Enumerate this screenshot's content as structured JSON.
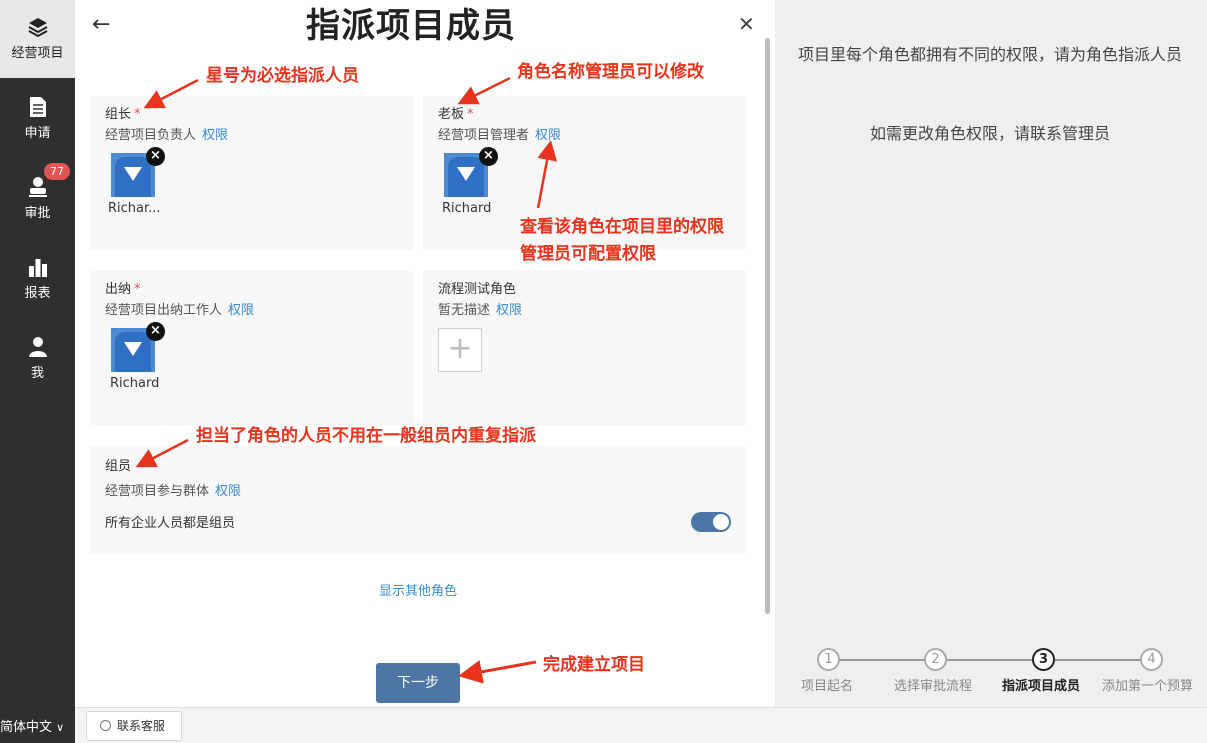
{
  "nav": {
    "items": [
      {
        "label": "经营项目",
        "icon": "layers-icon"
      },
      {
        "label": "申请",
        "icon": "document-icon"
      },
      {
        "label": "审批",
        "icon": "stamp-icon"
      },
      {
        "label": "报表",
        "icon": "bar-chart-icon"
      },
      {
        "label": "我",
        "icon": "person-icon"
      }
    ],
    "badge": "77",
    "language": "简体中文"
  },
  "dialog": {
    "title": "指派项目成员",
    "roles": [
      {
        "name": "组长",
        "required": "*",
        "desc": "经营项目负责人",
        "perm": "权限",
        "members": [
          "Richar..."
        ]
      },
      {
        "name": "老板",
        "required": "*",
        "desc": "经营项目管理者",
        "perm": "权限",
        "members": [
          "Richard"
        ]
      },
      {
        "name": "出纳",
        "required": "*",
        "desc": "经营项目出纳工作人",
        "perm": "权限",
        "members": [
          "Richard"
        ]
      },
      {
        "name": "流程测试角色",
        "required": "",
        "desc": "暂无描述",
        "perm": "权限",
        "members": [],
        "add": "+"
      },
      {
        "name": "组员",
        "required": "",
        "desc": "经营项目参与群体",
        "perm": "权限",
        "toggle_label": "所有企业人员都是组员",
        "toggle_on": true
      }
    ],
    "show_more": "显示其他角色",
    "next_button": "下一步"
  },
  "annotations": {
    "required": "星号为必选指派人员",
    "rename": "角色名称管理员可以修改",
    "perm_line1": "查看该角色在项目里的权限",
    "perm_line2": "管理员可配置权限",
    "members": "担当了角色的人员不用在一般组员内重复指派",
    "finish": "完成建立项目",
    "color": "#e8341c"
  },
  "right_panel": {
    "info1": "项目里每个角色都拥有不同的权限，请为角色指派人员",
    "info2": "如需更改角色权限，请联系管理员",
    "steps": [
      {
        "num": "1",
        "label": "项目起名"
      },
      {
        "num": "2",
        "label": "选择审批流程"
      },
      {
        "num": "3",
        "label": "指派项目成员",
        "active": true
      },
      {
        "num": "4",
        "label": "添加第一个预算"
      }
    ]
  },
  "footer": {
    "support": "联系客服"
  }
}
